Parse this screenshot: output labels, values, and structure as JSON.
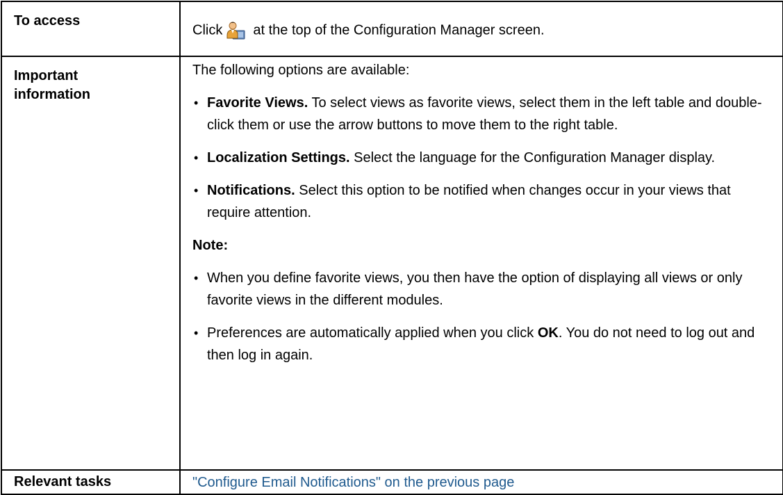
{
  "rows": {
    "access": {
      "label": "To access",
      "before_icon": "Click",
      "icon": "user-preferences-icon",
      "after_icon": "at the top of the Configuration Manager screen."
    },
    "important": {
      "label_line1": "Important",
      "label_line2": "information",
      "intro": "The following options are available:",
      "options": [
        {
          "term": "Favorite Views.",
          "text": " To select views as favorite views, select them in the left table and double-click them or use the arrow buttons to move them to the right table."
        },
        {
          "term": "Localization Settings.",
          "text": " Select the language for the Configuration Manager display."
        },
        {
          "term": "Notifications.",
          "text": " Select this option to be notified when changes occur in your views that require attention."
        }
      ],
      "note_title": "Note:",
      "notes": [
        {
          "text": "When you define favorite views, you then have the option of displaying all views or only favorite views in the different modules."
        },
        {
          "pre": "Preferences are automatically applied when you click ",
          "bold": "OK",
          "post": ". You do not need to log out and then log in again."
        }
      ]
    },
    "tasks": {
      "label": "Relevant tasks",
      "link": "\"Configure Email Notifications\" on the previous page"
    }
  },
  "colors": {
    "link": "#1f5a8e",
    "border": "#000000"
  }
}
